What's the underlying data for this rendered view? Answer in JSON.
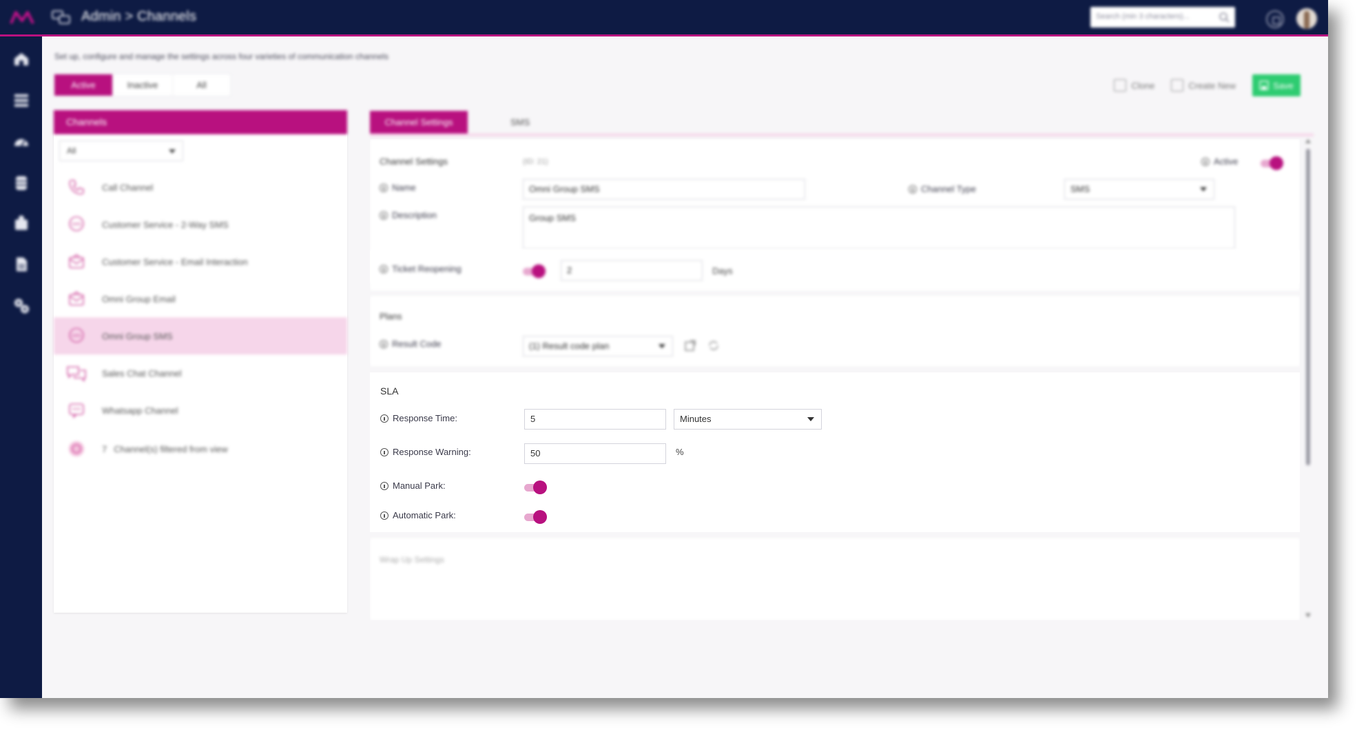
{
  "topbar": {
    "breadcrumb": "Admin > Channels",
    "search_placeholder": "Search (min 3 characters)...",
    "logo_icon": "brand-logo-icon",
    "colors": {
      "bar": "#0e1b44",
      "accent": "#b8117f",
      "save": "#2ecc71"
    }
  },
  "nav": {
    "items": [
      {
        "icon": "home-icon"
      },
      {
        "icon": "list-icon"
      },
      {
        "icon": "dashboard-icon"
      },
      {
        "icon": "database-icon"
      },
      {
        "icon": "users-icon"
      },
      {
        "icon": "document-icon"
      },
      {
        "icon": "settings-icon"
      }
    ]
  },
  "page": {
    "description": "Set up, configure and manage the settings across four varieties of communication channels",
    "filters": [
      "Active",
      "Inactive",
      "All"
    ],
    "actions": {
      "clone": "Clone",
      "create_new": "Create New",
      "save": "Save"
    }
  },
  "channels": {
    "header": "Channels",
    "filter_value": "All",
    "items": [
      {
        "label": "Call Channel",
        "icon": "phone-icon"
      },
      {
        "label": "Customer Service - 2-Way SMS",
        "icon": "sms-icon"
      },
      {
        "label": "Customer Service - Email Interaction",
        "icon": "email-icon"
      },
      {
        "label": "Omni Group Email",
        "icon": "email-icon"
      },
      {
        "label": "Omni Group SMS",
        "icon": "sms-icon",
        "selected": true
      },
      {
        "label": "Sales Chat Channel",
        "icon": "chat-icon"
      },
      {
        "label": "Whatsapp Channel",
        "icon": "whatsapp-icon"
      }
    ],
    "filtered_note": {
      "count": "7",
      "text": "Channel(s) filtered from view"
    }
  },
  "settings": {
    "tabs": [
      "Channel Settings",
      "SMS"
    ],
    "channel_settings": {
      "title": "Channel Settings",
      "id_text": "(ID: 21)",
      "active_label": "Active",
      "name_label": "Name",
      "name_value": "Omni Group SMS",
      "channel_type_label": "Channel Type",
      "channel_type_value": "SMS",
      "description_label": "Description",
      "description_value": "Group SMS",
      "ticket_reopening_label": "Ticket Reopening",
      "ticket_reopening_value": "2",
      "ticket_reopening_unit": "Days"
    },
    "plans": {
      "title": "Plans",
      "result_code_label": "Result Code",
      "result_code_value": "(1) Result code plan"
    },
    "sla": {
      "title": "SLA",
      "response_time_label": "Response Time:",
      "response_time_value": "5",
      "response_time_unit": "Minutes",
      "response_warning_label": "Response Warning:",
      "response_warning_value": "50",
      "response_warning_unit": "%",
      "manual_park_label": "Manual Park:",
      "automatic_park_label": "Automatic Park:"
    },
    "next_section_title": "Wrap Up Settings"
  }
}
